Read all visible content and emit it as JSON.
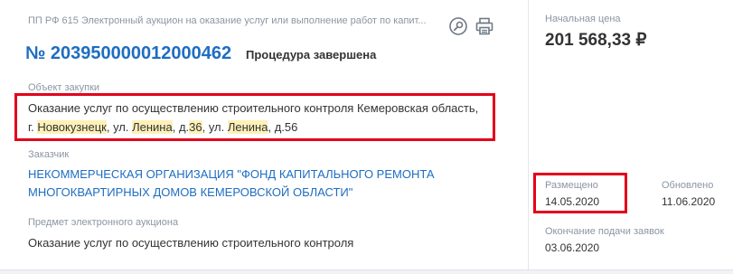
{
  "procedure": {
    "type": "ПП РФ 615 Электронный аукцион на оказание услуг или выполнение работ по капит...",
    "number": "№ 203950000012000462",
    "status": "Процедура завершена"
  },
  "purchase_object": {
    "label": "Объект закупки",
    "line1": "Оказание услуг по осуществлению строительного контроля Кемеровская область,",
    "line2_parts": {
      "p1": "г. ",
      "h1": "Новокузнецк",
      "p2": ", ул. ",
      "h2": "Ленина",
      "p3": ", д.",
      "h3": "36",
      "p4": ", ул. ",
      "h4": "Ленина",
      "p5": ", д.56"
    }
  },
  "customer": {
    "label": "Заказчик",
    "line1": "НЕКОММЕРЧЕСКАЯ ОРГАНИЗАЦИЯ \"ФОНД КАПИТАЛЬНОГО РЕМОНТА",
    "line2": "МНОГОКВАРТИРНЫХ ДОМОВ КЕМЕРОВСКОЙ ОБЛАСТИ\""
  },
  "subject": {
    "label": "Предмет электронного аукциона",
    "value": "Оказание услуг по осуществлению строительного контроля"
  },
  "price": {
    "label": "Начальная цена",
    "value": "201 568,33 ₽"
  },
  "dates": {
    "posted_label": "Размещено",
    "posted_value": "14.05.2020",
    "updated_label": "Обновлено",
    "updated_value": "11.06.2020",
    "deadline_label": "Окончание подачи заявок",
    "deadline_value": "03.06.2020"
  },
  "icons": {
    "search": "search-icon",
    "print": "print-icon"
  },
  "colors": {
    "link": "#1e6dc1",
    "highlight": "#fdf1b8",
    "annotation": "#e3001b"
  }
}
